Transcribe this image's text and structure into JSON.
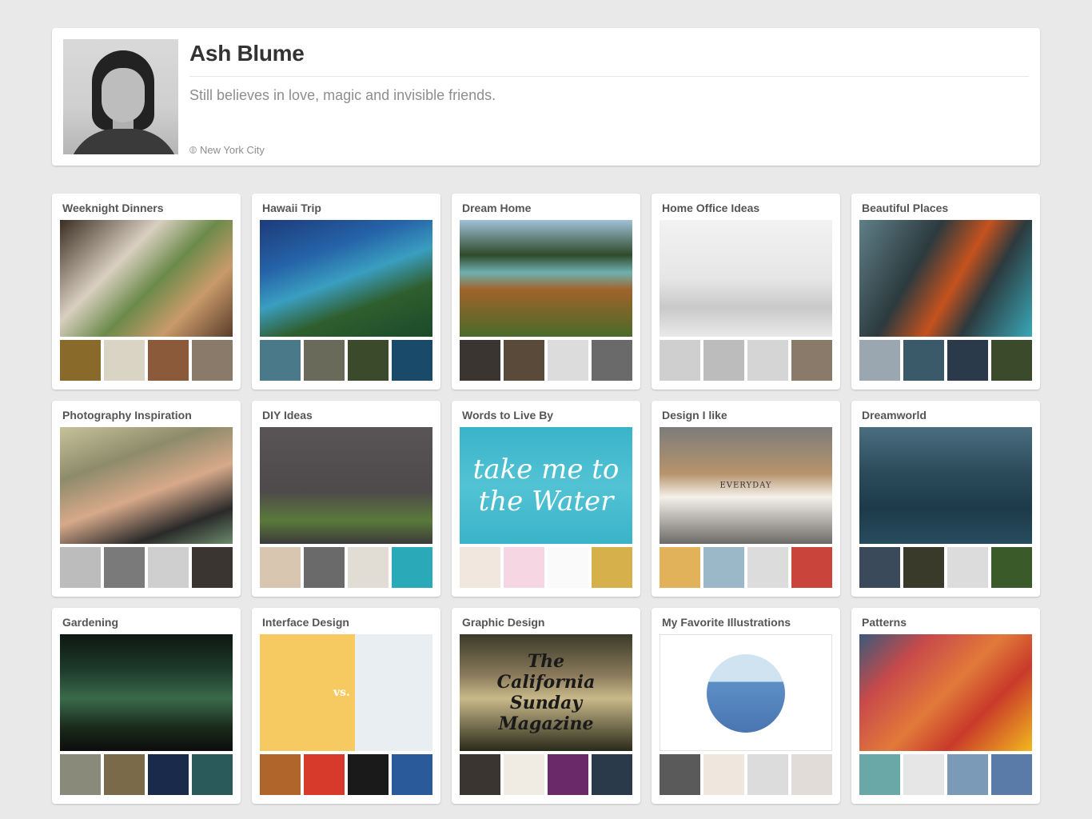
{
  "profile": {
    "name": "Ash Blume",
    "bio": "Still believes in love, magic and invisible friends.",
    "location": "New York City",
    "location_icon": "globe-icon"
  },
  "boards": [
    {
      "id": "weeknight-dinners",
      "title": "Weeknight Dinners",
      "cover": "linear-gradient(135deg,#3b2d22 0%,#d9cfc0 35%,#6b8a4a 55%,#c99a6a 75%,#5a3d2a 100%)",
      "thumbs": [
        "#8a6a2a",
        "#d9d4c4",
        "#8a5a3a",
        "#8a7a6a"
      ]
    },
    {
      "id": "hawaii-trip",
      "title": "Hawaii Trip",
      "cover": "linear-gradient(160deg,#1d3b7a 0%,#2563a8 30%,#3a9ec0 50%,#2f5e2e 70%,#1a4a2a 100%)",
      "thumbs": [
        "#4a7a8a",
        "#6a6a5a",
        "#3a4a2a",
        "#1a4a6a"
      ]
    },
    {
      "id": "dream-home",
      "title": "Dream Home",
      "cover": "linear-gradient(180deg,#9fc1d8 0%,#2f4a2a 30%,#6fb0b0 45%,#a0632a 60%,#4a6a2a 100%)",
      "thumbs": [
        "#3a3530",
        "#5a4a3a",
        "#dcdcdc",
        "#6a6a6a"
      ]
    },
    {
      "id": "home-office-ideas",
      "title": "Home Office Ideas",
      "cover": "linear-gradient(180deg,#f2f2f2 0%,#e6e6e6 50%,#c9c9c9 75%,#e9e9e9 100%)",
      "thumbs": [
        "#cfcfcf",
        "#bcbcbc",
        "#d5d5d5",
        "#8a7a6a"
      ]
    },
    {
      "id": "beautiful-places",
      "title": "Beautiful Places",
      "cover": "linear-gradient(120deg,#5f7f88 0%,#2c3a3e 35%,#c5521e 55%,#2c3a3e 70%,#39a8b8 100%)",
      "thumbs": [
        "#9aa6b0",
        "#3a5a6a",
        "#2a3a4a",
        "#3a4a2a"
      ]
    },
    {
      "id": "photography-inspiration",
      "title": "Photography Inspiration",
      "cover": "linear-gradient(160deg,#c6c29a 0%,#8e8b6a 30%,#d7a98a 55%,#2a2a2a 80%,#6a8a6a 100%)",
      "thumbs": [
        "#bcbcbc",
        "#7a7a7a",
        "#cfcfcf",
        "#3a3530"
      ]
    },
    {
      "id": "diy-ideas",
      "title": "DIY Ideas",
      "cover": "linear-gradient(180deg,#595556 0%,#4e4a4b 55%,#5a7a3a 80%,#3c3a3a 100%)",
      "thumbs": [
        "#d9c6b0",
        "#6a6a6a",
        "#e1ddd4",
        "#2aa9b8"
      ]
    },
    {
      "id": "words-to-live-by",
      "title": "Words to Live By",
      "cover": "linear-gradient(180deg,#3ab3c9 0%,#52c3d4 50%,#3ab3c9 100%)",
      "cover_text": "take me to the Water",
      "thumbs": [
        "#f1e7de",
        "#f5d6e2",
        "#fafafa",
        "#d6b04a"
      ]
    },
    {
      "id": "design-i-like",
      "title": "Design I like",
      "cover": "linear-gradient(180deg,#7c7c7a 0%,#b7946c 40%,#f4f1ea 60%,#6d6b68 100%)",
      "cover_text": "EVERYDAY",
      "thumbs": [
        "#e2b25a",
        "#9ab8c8",
        "#dcdcdc",
        "#c9443a"
      ]
    },
    {
      "id": "dreamworld",
      "title": "Dreamworld",
      "cover": "linear-gradient(180deg,#4a6e80 0%,#2a4a5a 40%,#1d3a4a 70%,#264c5e 100%)",
      "thumbs": [
        "#3a4a5a",
        "#3a3a2a",
        "#dcdcdc",
        "#3a5a2a"
      ]
    },
    {
      "id": "gardening",
      "title": "Gardening",
      "cover": "linear-gradient(180deg,#0f1712 0%,#1d3a2a 30%,#3a6a4a 55%,#1a2a1a 80%,#0d0d0d 100%)",
      "thumbs": [
        "#8a8a7a",
        "#7a6a4a",
        "#1a2a4a",
        "#2a5a5a"
      ]
    },
    {
      "id": "interface-design",
      "title": "Interface Design",
      "cover": "linear-gradient(90deg,#f6ca61 0%,#f6ca61 55%,#e9eef2 55%,#e9eef2 100%)",
      "cover_text": "vs.",
      "thumbs": [
        "#b0662a",
        "#d73a2a",
        "#1a1a1a",
        "#2a5a9a"
      ]
    },
    {
      "id": "graphic-design",
      "title": "Graphic Design",
      "cover": "linear-gradient(180deg,#3a3a2a 0%,#8a7a5a 35%,#c9b98a 55%,#2a2a1a 100%)",
      "cover_text": "The California Sunday Magazine",
      "thumbs": [
        "#3a3530",
        "#f0ece4",
        "#6a2a6a",
        "#2a3a4a"
      ]
    },
    {
      "id": "my-favorite-illustrations",
      "title": "My Favorite Illustrations",
      "cover": "#ffffff",
      "thumbs": [
        "#5a5a5a",
        "#efe7de",
        "#dcdcdc",
        "#e2dcd8"
      ]
    },
    {
      "id": "patterns",
      "title": "Patterns",
      "cover": "linear-gradient(135deg,#3a5a7a 0%,#c94a4a 25%,#e17a3a 50%,#c93a2a 70%,#f2b81e 100%)",
      "thumbs": [
        "#6aa8a8",
        "#e6e6e6",
        "#7a9ab8",
        "#5a7aa8"
      ]
    }
  ]
}
